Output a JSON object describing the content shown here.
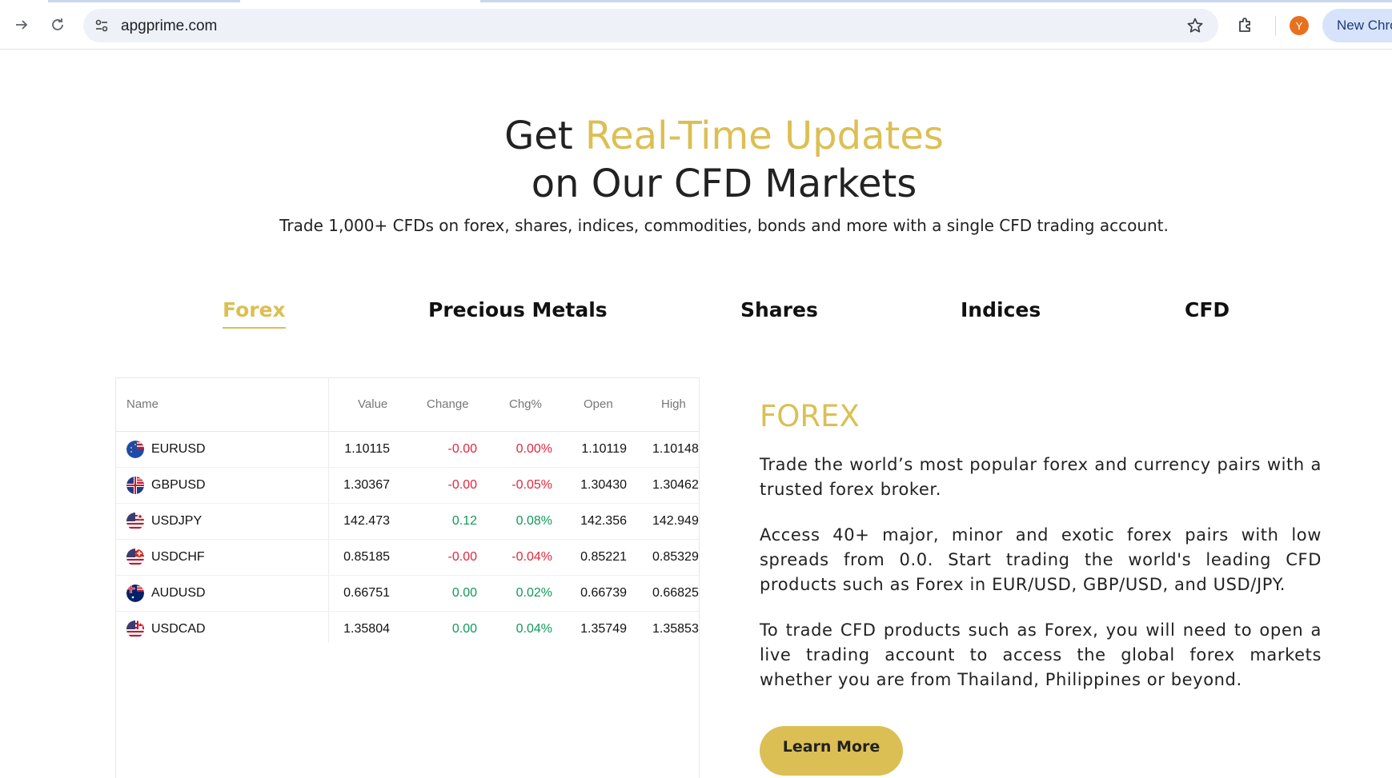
{
  "browser": {
    "url": "apgprime.com",
    "avatar_letter": "Y",
    "new_chrome_label": "New Chrome"
  },
  "hero": {
    "title_part1": "Get ",
    "title_highlight": "Real-Time Updates",
    "title_line2": "on Our CFD Markets",
    "subtitle": "Trade 1,000+ CFDs on forex, shares, indices, commodities, bonds and more with a single CFD trading account."
  },
  "tabs": [
    {
      "label": "Forex",
      "active": true
    },
    {
      "label": "Precious Metals",
      "active": false
    },
    {
      "label": "Shares",
      "active": false
    },
    {
      "label": "Indices",
      "active": false
    },
    {
      "label": "CFD",
      "active": false
    }
  ],
  "table": {
    "headers": [
      "Name",
      "Value",
      "Change",
      "Chg%",
      "Open",
      "High"
    ],
    "rows": [
      {
        "name": "EURUSD",
        "value": "1.10115",
        "change": "-0.00",
        "chg_pct": "0.00%",
        "open": "1.10119",
        "high": "1.10148",
        "dir": "neg"
      },
      {
        "name": "GBPUSD",
        "value": "1.30367",
        "change": "-0.00",
        "chg_pct": "-0.05%",
        "open": "1.30430",
        "high": "1.30462",
        "dir": "neg"
      },
      {
        "name": "USDJPY",
        "value": "142.473",
        "change": "0.12",
        "chg_pct": "0.08%",
        "open": "142.356",
        "high": "142.949",
        "dir": "pos"
      },
      {
        "name": "USDCHF",
        "value": "0.85185",
        "change": "-0.00",
        "chg_pct": "-0.04%",
        "open": "0.85221",
        "high": "0.85329",
        "dir": "neg"
      },
      {
        "name": "AUDUSD",
        "value": "0.66751",
        "change": "0.00",
        "chg_pct": "0.02%",
        "open": "0.66739",
        "high": "0.66825",
        "dir": "pos"
      },
      {
        "name": "USDCAD",
        "value": "1.35804",
        "change": "0.00",
        "chg_pct": "0.04%",
        "open": "1.35749",
        "high": "1.35853",
        "dir": "pos"
      }
    ]
  },
  "info": {
    "title": "FOREX",
    "paragraphs": [
      "Trade the world’s most popular forex and currency pairs with a trusted forex broker.",
      "Access 40+ major, minor and exotic forex pairs with low spreads from 0.0. Start trading the world's leading CFD products such as Forex in EUR/USD, GBP/USD, and USD/JPY.",
      "To trade CFD products such as Forex, you will need to open a live trading account to access the global forex markets whether you are from Thailand, Philippines or beyond."
    ],
    "cta_label": "Learn More"
  },
  "colors": {
    "gold": "#dcbf54",
    "negative": "#e0283c",
    "positive": "#11995a"
  }
}
